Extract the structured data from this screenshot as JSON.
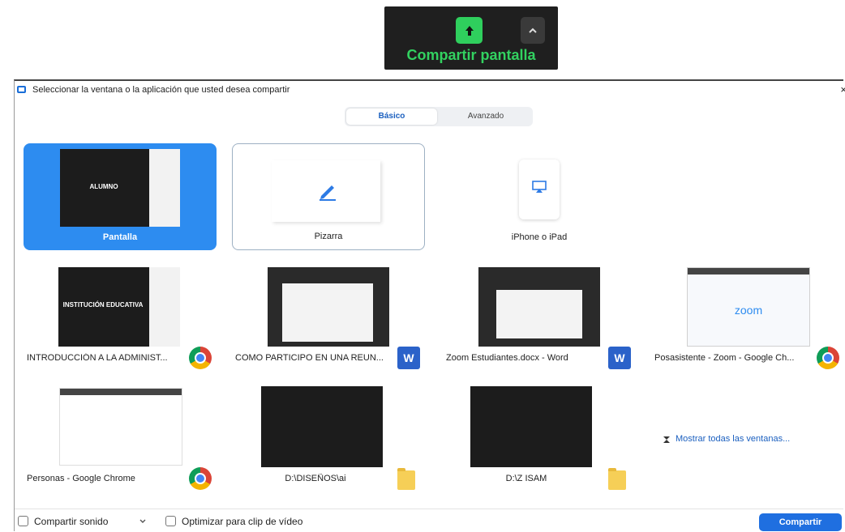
{
  "toolbar": {
    "label": "Compartir pantalla",
    "accent": "#32d260"
  },
  "dialog": {
    "title": "Seleccionar la ventana o la aplicación que usted desea compartir",
    "close": "×",
    "tabs": [
      {
        "label": "Básico",
        "selected": true
      },
      {
        "label": "Avanzado",
        "selected": false
      }
    ]
  },
  "cards": {
    "pantalla": {
      "label": "Pantalla",
      "thumb_text": "ALUMNO"
    },
    "pizarra": {
      "label": "Pizarra"
    },
    "iphone": {
      "label": "iPhone o iPad"
    },
    "intro": {
      "label": "INTRODUCCIÓN A LA ADMINIST...",
      "thumb_text": "INSTITUCIÓN EDUCATIVA",
      "app": "chrome-icon"
    },
    "como": {
      "label": "COMO PARTICIPO EN UNA REUN...",
      "app": "word-icon",
      "app_glyph": "W"
    },
    "zoom_est": {
      "label": "Zoom Estudiantes.docx - Word",
      "app": "word-icon",
      "app_glyph": "W"
    },
    "posasistente": {
      "label": "Posasistente - Zoom - Google Ch...",
      "thumb_text": "zoom",
      "app": "chrome-icon"
    },
    "personas": {
      "label": "Personas - Google Chrome",
      "app": "chrome-icon"
    },
    "disenos": {
      "label": "D:\\DISEÑOS\\ai",
      "app": "folder-icon"
    },
    "isam": {
      "label": "D:\\Z ISAM",
      "app": "folder-icon"
    },
    "mostrar": {
      "label": "Mostrar todas las ventanas..."
    }
  },
  "bottom": {
    "compartir_sonido": "Compartir sonido",
    "optimizar": "Optimizar para clip de vídeo",
    "share_button": "Compartir"
  }
}
